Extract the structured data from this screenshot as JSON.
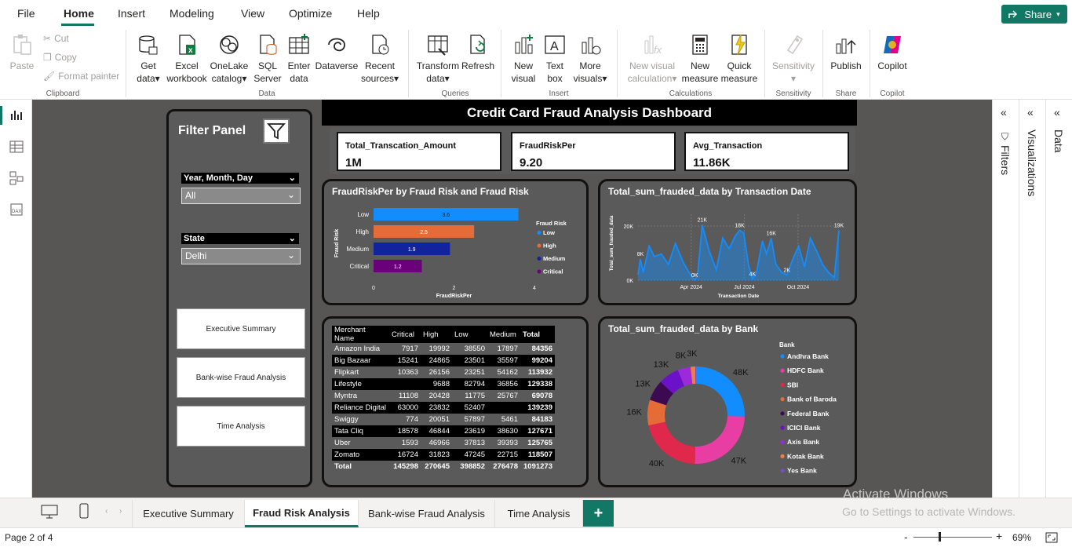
{
  "menu": {
    "items": [
      "File",
      "Home",
      "Insert",
      "Modeling",
      "View",
      "Optimize",
      "Help"
    ],
    "active": "Home",
    "share": "Share"
  },
  "ribbon": {
    "clipboard": {
      "paste": "Paste",
      "cut": "Cut",
      "copy": "Copy",
      "format_painter": "Format painter",
      "group": "Clipboard"
    },
    "data": {
      "get_data": [
        "Get",
        "data"
      ],
      "excel": [
        "Excel",
        "workbook"
      ],
      "onelake": [
        "OneLake",
        "catalog"
      ],
      "sql": [
        "SQL",
        "Server"
      ],
      "enter": [
        "Enter",
        "data"
      ],
      "dataverse": "Dataverse",
      "recent": [
        "Recent",
        "sources"
      ],
      "group": "Data"
    },
    "queries": {
      "transform": [
        "Transform",
        "data"
      ],
      "refresh": "Refresh",
      "group": "Queries"
    },
    "insert": {
      "new_visual": [
        "New",
        "visual"
      ],
      "text_box": [
        "Text",
        "box"
      ],
      "more_visuals": [
        "More",
        "visuals"
      ],
      "group": "Insert"
    },
    "calculations": {
      "new_visual_calc": [
        "New visual",
        "calculation"
      ],
      "new_measure": [
        "New",
        "measure"
      ],
      "quick_measure": [
        "Quick",
        "measure"
      ],
      "group": "Calculations"
    },
    "sensitivity": {
      "label": "Sensitivity",
      "group": "Sensitivity"
    },
    "share": {
      "publish": "Publish",
      "group": "Share"
    },
    "copilot": {
      "label": "Copilot",
      "group": "Copilot"
    }
  },
  "panes": {
    "filters": "Filters",
    "visualizations": "Visualizations",
    "data": "Data"
  },
  "report": {
    "title": "Credit Card Fraud Analysis Dashboard",
    "filter_panel": {
      "title": "Filter Panel",
      "slicer1_label": "Year, Month, Day",
      "slicer1_value": "All",
      "slicer2_label": "State",
      "slicer2_value": "Delhi",
      "nav_buttons": [
        "Executive Summary",
        "Bank-wise Fraud Analysis",
        "Time Analysis"
      ]
    },
    "kpis": [
      {
        "label": "Total_Transcation_Amount",
        "value": "1M"
      },
      {
        "label": "FraudRiskPer",
        "value": "9.20"
      },
      {
        "label": "Avg_Transaction",
        "value": "11.86K"
      }
    ]
  },
  "chart_data": [
    {
      "type": "bar",
      "orientation": "horizontal",
      "title": "FraudRiskPer by Fraud Risk and Fraud Risk",
      "xlabel": "FraudRiskPer",
      "ylabel": "Fraud Risk",
      "categories": [
        "Low",
        "High",
        "Medium",
        "Critical"
      ],
      "values": [
        3.6,
        2.5,
        1.9,
        1.2
      ],
      "colors": [
        "#118dff",
        "#e66c37",
        "#12239e",
        "#6b007b"
      ],
      "xlim": [
        0,
        4
      ],
      "xticks": [
        "0",
        "2",
        "4"
      ],
      "legend": {
        "title": "Fraud Risk",
        "entries": [
          "Low",
          "High",
          "Medium",
          "Critical"
        ],
        "placement": "right"
      }
    },
    {
      "type": "area",
      "title": "Total_sum_frauded_data by Transaction Date",
      "xlabel": "Transaction Date",
      "ylabel": "Total_sum_frauded_data",
      "color": "#118dff",
      "yticks": [
        "0K",
        "20K"
      ],
      "xticks": [
        "Apr 2024",
        "Jul 2024",
        "Oct 2024"
      ],
      "x": [
        "2024-01-01",
        "2024-01-05",
        "2024-01-10",
        "2024-01-20",
        "2024-01-29",
        "2024-02-10",
        "2024-02-22",
        "2024-03-05",
        "2024-03-18",
        "2024-03-28",
        "2024-04-02",
        "2024-04-07",
        "2024-04-12",
        "2024-04-20",
        "2024-05-02",
        "2024-05-14",
        "2024-05-25",
        "2024-06-05",
        "2024-06-16",
        "2024-06-23",
        "2024-06-30",
        "2024-07-08",
        "2024-07-15",
        "2024-07-22",
        "2024-08-01",
        "2024-08-08",
        "2024-08-16",
        "2024-08-24",
        "2024-09-03",
        "2024-09-12",
        "2024-09-22",
        "2024-10-02",
        "2024-10-12",
        "2024-10-22",
        "2024-11-02",
        "2024-11-12",
        "2024-11-22",
        "2024-12-02",
        "2024-12-10"
      ],
      "y": [
        2000,
        8000,
        3000,
        13000,
        9000,
        10000,
        6000,
        14000,
        7000,
        3000,
        1500,
        0,
        2000,
        21000,
        11000,
        4000,
        16000,
        12000,
        17000,
        19000,
        18000,
        6000,
        400,
        3000,
        15000,
        10000,
        16000,
        6000,
        3000,
        2000,
        8000,
        13000,
        5000,
        16000,
        11000,
        6000,
        3000,
        1000,
        19000
      ],
      "data_labels": [
        {
          "x": "2024-01-05",
          "text": "8K"
        },
        {
          "x": "2024-04-07",
          "text": "0K"
        },
        {
          "x": "2024-04-20",
          "text": "21K"
        },
        {
          "x": "2024-06-23",
          "text": "18K"
        },
        {
          "x": "2024-07-15",
          "text": "4K"
        },
        {
          "x": "2024-08-16",
          "text": "16K"
        },
        {
          "x": "2024-09-12",
          "text": "2K"
        },
        {
          "x": "2024-12-10",
          "text": "19K"
        }
      ]
    },
    {
      "type": "table",
      "columns": [
        "Merchant Name",
        "Critical",
        "High",
        "Low",
        "Medium",
        "Total"
      ],
      "rows": [
        [
          "Amazon India",
          "7917",
          "19992",
          "38550",
          "17897",
          "84356"
        ],
        [
          "Big Bazaar",
          "15241",
          "24865",
          "23501",
          "35597",
          "99204"
        ],
        [
          "Flipkart",
          "10363",
          "26156",
          "23251",
          "54162",
          "113932"
        ],
        [
          "Lifestyle",
          "",
          "9688",
          "82794",
          "36856",
          "129338"
        ],
        [
          "Myntra",
          "11108",
          "20428",
          "11775",
          "25767",
          "69078"
        ],
        [
          "Reliance Digital",
          "63000",
          "23832",
          "52407",
          "",
          "139239"
        ],
        [
          "Swiggy",
          "774",
          "20051",
          "57897",
          "5461",
          "84183"
        ],
        [
          "Tata Cliq",
          "18578",
          "46844",
          "23619",
          "38630",
          "127671"
        ],
        [
          "Uber",
          "1593",
          "46966",
          "37813",
          "39393",
          "125765"
        ],
        [
          "Zomato",
          "16724",
          "31823",
          "47245",
          "22715",
          "118507"
        ]
      ],
      "total": [
        "Total",
        "145298",
        "270645",
        "398852",
        "276478",
        "1091273"
      ]
    },
    {
      "type": "pie",
      "donut": true,
      "title": "Total_sum_frauded_data by Bank",
      "legend": {
        "title": "Bank",
        "placement": "right"
      },
      "labels": [
        "Andhra Bank",
        "HDFC Bank",
        "SBI",
        "Bank of Baroda",
        "Federal Bank",
        "ICICI Bank",
        "Axis Bank",
        "Kotak Bank",
        "Yes Bank"
      ],
      "values": [
        48,
        47,
        40,
        16,
        13,
        13,
        8,
        3,
        0.5
      ],
      "display_labels": [
        "48K",
        "47K",
        "40K",
        "16K",
        "13K",
        "13K",
        "8K",
        "3K",
        ""
      ],
      "colors": [
        "#118dff",
        "#e83ea3",
        "#e0274c",
        "#e66c37",
        "#3b0a50",
        "#6b11c9",
        "#9b2bd9",
        "#f07c45",
        "#744ec2"
      ]
    }
  ],
  "tabs": {
    "pages": [
      "Executive Summary",
      "Fraud Risk Analysis",
      "Bank-wise Fraud Analysis",
      "Time Analysis"
    ],
    "active": "Fraud Risk Analysis",
    "add": "+"
  },
  "watermark": {
    "line1": "Activate Windows",
    "line2": "Go to Settings to activate Windows."
  },
  "status": {
    "page": "Page 2 of 4",
    "zoom": "69%",
    "zoom_minus": "-",
    "zoom_plus": "+"
  }
}
